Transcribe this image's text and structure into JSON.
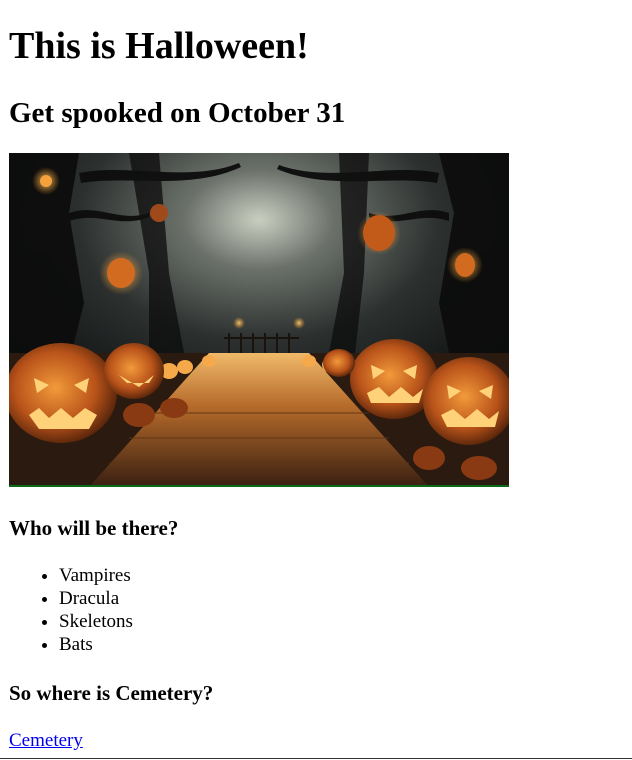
{
  "header": {
    "title": "This is Halloween!",
    "subtitle": "Get spooked on October 31"
  },
  "hero_image": {
    "alt": "Spooky forest path lined with glowing jack-o'-lanterns",
    "colors": {
      "sky": "#2b2f2e",
      "glow": "#f7a431",
      "pumpkin": "#e0701c",
      "ground": "#3a2415"
    }
  },
  "guests": {
    "heading": "Who will be there?",
    "items": [
      "Vampires",
      "Dracula",
      "Skeletons",
      "Bats"
    ]
  },
  "location": {
    "heading": "So where is Cemetery?",
    "link_label": "Cemetery"
  }
}
